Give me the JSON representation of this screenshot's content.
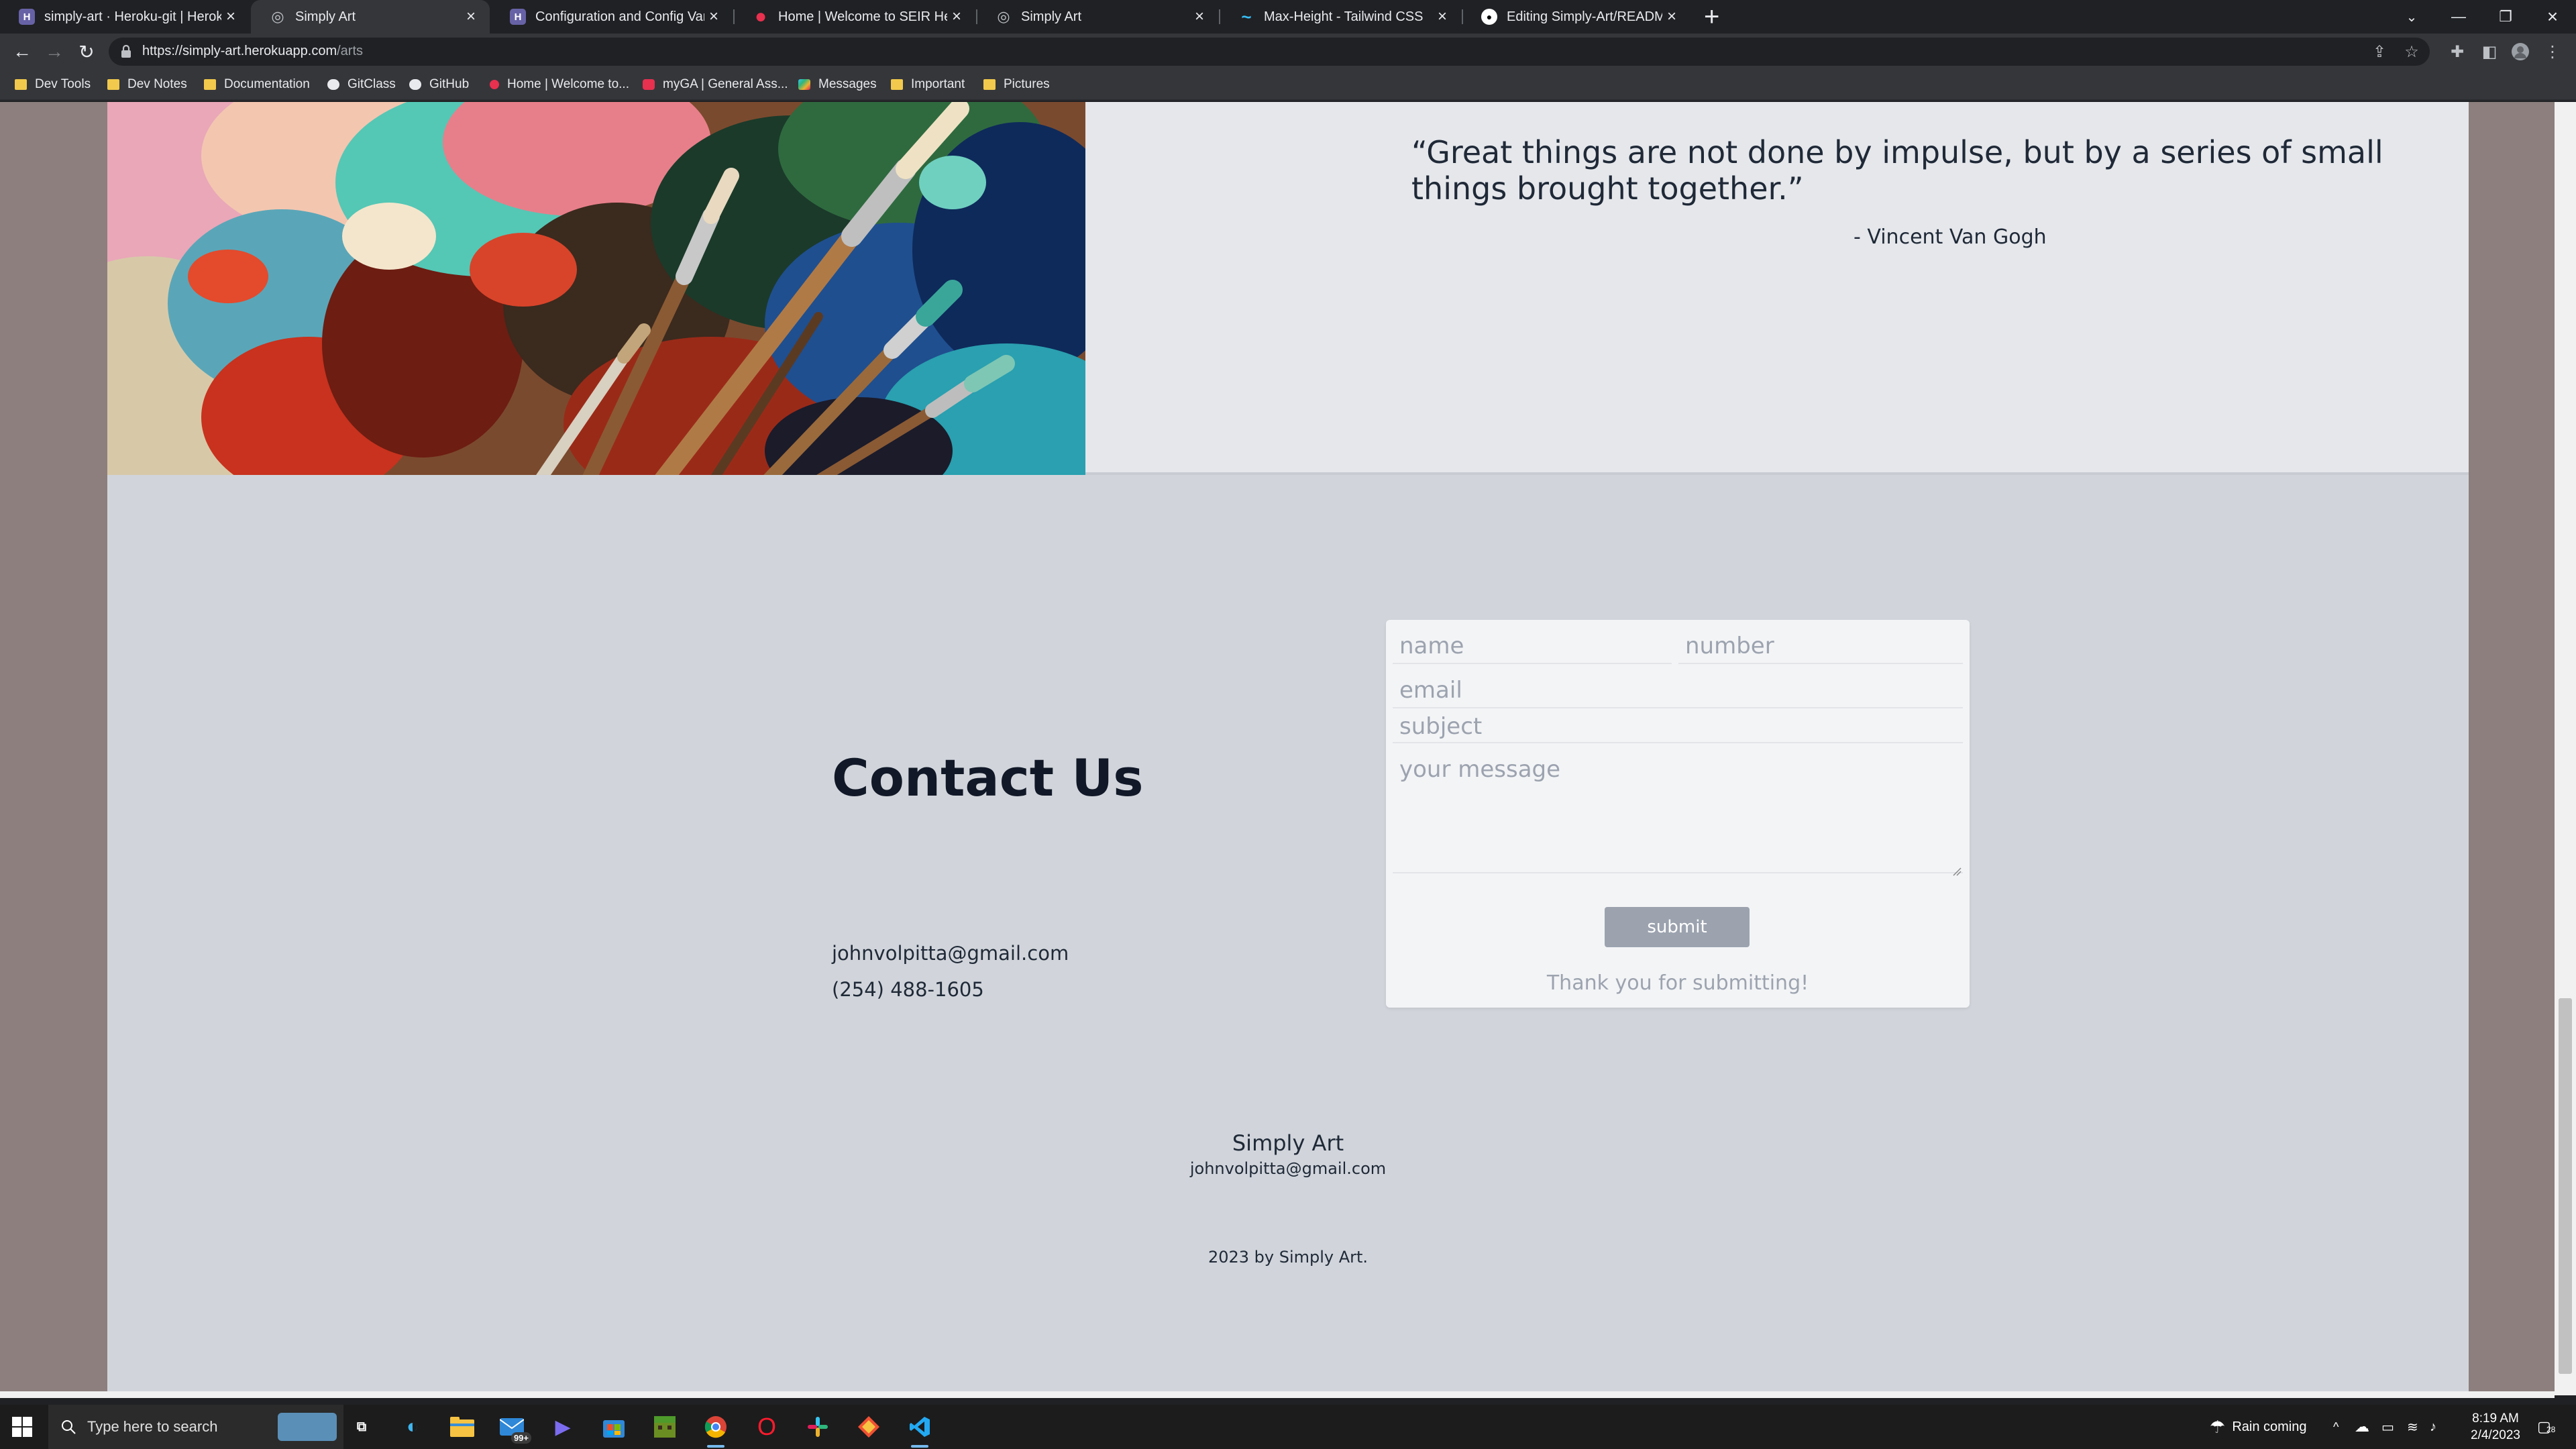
{
  "browser": {
    "tabs": [
      {
        "title": "simply-art · Heroku-git | Heroku",
        "fav_color": "#6762a6",
        "fav_glyph": "H"
      },
      {
        "title": "Simply Art",
        "fav_color": "#5f6368",
        "fav_glyph": "◎"
      },
      {
        "title": "Configuration and Config Vars | H",
        "fav_color": "#6762a6",
        "fav_glyph": "H"
      },
      {
        "title": "Home | Welcome to SEIR Hedwig",
        "fav_color": "#e8304f",
        "fav_glyph": "•"
      },
      {
        "title": "Simply Art",
        "fav_color": "#5f6368",
        "fav_glyph": "◎"
      },
      {
        "title": "Max-Height - Tailwind CSS",
        "fav_color": "#38bdf8",
        "fav_glyph": "~"
      },
      {
        "title": "Editing Simply-Art/README.md at",
        "fav_color": "#ffffff",
        "fav_glyph": "●"
      }
    ],
    "url_host": "https://simply-art.herokuapp.com",
    "url_path": "/arts",
    "bookmarks": [
      {
        "label": "Dev Tools"
      },
      {
        "label": "Dev Notes"
      },
      {
        "label": "Documentation"
      },
      {
        "label": "GitClass"
      },
      {
        "label": "GitHub"
      },
      {
        "label": "Home | Welcome to..."
      },
      {
        "label": "myGA | General Ass..."
      },
      {
        "label": "Messages"
      },
      {
        "label": "Important"
      },
      {
        "label": "Pictures"
      }
    ]
  },
  "page": {
    "quote": {
      "text": "“Great things are not done by impulse, but by a series of small things brought together.”",
      "author": "- Vincent Van Gogh"
    },
    "contact": {
      "heading": "Contact Us",
      "email": "johnvolpitta@gmail.com",
      "phone": "(254) 488-1605"
    },
    "form": {
      "name_placeholder": "name",
      "number_placeholder": "number",
      "email_placeholder": "email",
      "subject_placeholder": "subject",
      "message_placeholder": "your message",
      "submit_label": "submit",
      "thanks_text": "Thank you for submitting!"
    },
    "footer": {
      "brand": "Simply Art",
      "email": "johnvolpitta@gmail.com",
      "copyright": "2023 by Simply Art."
    }
  },
  "taskbar": {
    "search_placeholder": "Type here to search",
    "mail_badge": "99+",
    "weather": "Rain coming",
    "time": "8:19 AM",
    "date": "2/4/2023",
    "notifications": "28"
  },
  "colors": {
    "page_bg": "#d1d5db",
    "quote_bg": "#e5e7eb",
    "form_bg": "#f3f4f6",
    "submit_bg": "#9ca3af",
    "outer_bg": "#8c7f7d"
  }
}
